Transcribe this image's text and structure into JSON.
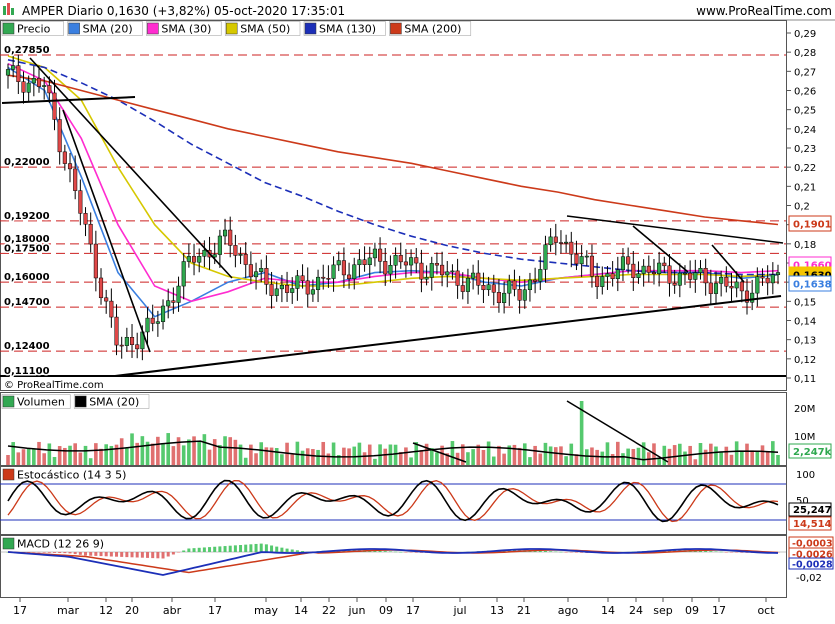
{
  "header": {
    "title": "AMPER Diario 0,1630 (+3,82%) 05-oct-2020 17:35:01",
    "site": "www.ProRealTime.com"
  },
  "price_panel": {
    "legend": [
      {
        "label": "Precio",
        "color": "#32a852",
        "icon": "candle-icon"
      },
      {
        "label": "SMA (20)",
        "color": "#3a7fe0"
      },
      {
        "label": "SMA (30)",
        "color": "#ff2cd0"
      },
      {
        "label": "SMA (50)",
        "color": "#d6c800"
      },
      {
        "label": "SMA (130)",
        "color": "#1c2fb8"
      },
      {
        "label": "SMA (200)",
        "color": "#cc3a1a"
      }
    ],
    "level_labels": [
      "0,27850",
      "0,22000",
      "0,19200",
      "0,18000",
      "0,17500",
      "0,16000",
      "0,14700",
      "0,12400",
      "0,11100"
    ],
    "right_badges": [
      {
        "text": "0,1901",
        "color": "#cc3a1a",
        "text_color": "#cc3a1a"
      },
      {
        "text": "0,1660",
        "color": "#ff2cd0",
        "text_color": "#ff2cd0"
      },
      {
        "text": "0,1630",
        "color": "#f5c500",
        "text_color": "#000000"
      },
      {
        "text": "0,1638",
        "color": "#3a7fe0",
        "text_color": "#3a7fe0"
      }
    ],
    "copyright": "© ProRealTime.com"
  },
  "volume_panel": {
    "legend": [
      {
        "label": "Volumen",
        "color": "#32a852",
        "icon": "bar-icon"
      },
      {
        "label": "SMA (20)",
        "color": "#000000"
      }
    ],
    "axis_ticks": [
      "20M",
      "10M"
    ],
    "badge": "2,247k"
  },
  "stoch_panel": {
    "legend": [
      {
        "label": "Estocástico (14 3 5)",
        "color": "#cc3a1a",
        "icon": "bar-icon"
      }
    ],
    "axis_ticks": [
      "100",
      "50",
      "0"
    ],
    "badges": [
      {
        "text": "25,247",
        "color": "#000000"
      },
      {
        "text": "14,514",
        "color": "#cc3a1a"
      }
    ]
  },
  "macd_panel": {
    "legend": [
      {
        "label": "MACD (12 26 9)",
        "color": "#32a852",
        "icon": "bar-icon"
      }
    ],
    "axis_ticks": [
      "0,00",
      "-0,02"
    ],
    "badges": [
      {
        "text": "-0,0003",
        "color": "#cc3a1a"
      },
      {
        "text": "-0,0026",
        "color": "#cc3a1a"
      },
      {
        "text": "-0,0028",
        "color": "#1c2fb8"
      }
    ]
  },
  "x_axis_labels": [
    "17",
    "mar",
    "12",
    "20",
    "abr",
    "17",
    "may",
    "14",
    "22",
    "jun",
    "09",
    "17",
    "jul",
    "13",
    "21",
    "ago",
    "14",
    "24",
    "sep",
    "09",
    "17",
    "oct"
  ],
  "chart_data": {
    "type": "line",
    "title": "AMPER Diario 0,1630 (+3,82%) 05-oct-2020 17:35:01",
    "y_axis_ticks": [
      "0,29",
      "0,28",
      "0,27",
      "0,26",
      "0,25",
      "0,24",
      "0,23",
      "0,22",
      "0,21",
      "0,2",
      "0,19",
      "0,18",
      "0,17",
      "0,16",
      "0,15",
      "0,14",
      "0,13",
      "0,12",
      "0,11"
    ],
    "ylim": [
      0.11,
      0.29
    ],
    "x": [
      "17",
      "mar",
      "12",
      "20",
      "abr",
      "17",
      "may",
      "14",
      "22",
      "jun",
      "09",
      "17",
      "jul",
      "13",
      "21",
      "ago",
      "14",
      "24",
      "sep",
      "09",
      "17",
      "oct"
    ],
    "series": [
      {
        "name": "Precio",
        "values": [
          0.268,
          0.262,
          0.195,
          0.125,
          0.138,
          0.172,
          0.182,
          0.158,
          0.157,
          0.166,
          0.172,
          0.169,
          0.164,
          0.157,
          0.153,
          0.185,
          0.162,
          0.168,
          0.164,
          0.162,
          0.155,
          0.163
        ]
      },
      {
        "name": "SMA (20)",
        "values": [
          0.272,
          0.26,
          0.215,
          0.165,
          0.142,
          0.15,
          0.16,
          0.165,
          0.158,
          0.16,
          0.165,
          0.166,
          0.165,
          0.16,
          0.158,
          0.162,
          0.164,
          0.166,
          0.165,
          0.165,
          0.162,
          0.1638
        ]
      },
      {
        "name": "SMA (30)",
        "values": [
          0.274,
          0.265,
          0.235,
          0.19,
          0.158,
          0.15,
          0.155,
          0.162,
          0.16,
          0.16,
          0.163,
          0.165,
          0.165,
          0.162,
          0.16,
          0.162,
          0.164,
          0.166,
          0.166,
          0.166,
          0.165,
          0.166
        ]
      },
      {
        "name": "SMA (50)",
        "values": [
          0.278,
          0.272,
          0.255,
          0.22,
          0.19,
          0.17,
          0.163,
          0.16,
          0.158,
          0.158,
          0.16,
          0.162,
          0.163,
          0.162,
          0.161,
          0.162,
          0.163,
          0.164,
          0.164,
          0.164,
          0.163,
          0.164
        ]
      },
      {
        "name": "SMA (130)",
        "values": [
          0.276,
          0.272,
          0.264,
          0.255,
          0.244,
          0.232,
          0.222,
          0.212,
          0.205,
          0.197,
          0.19,
          0.184,
          0.179,
          0.175,
          0.172,
          0.17,
          0.168,
          0.166,
          0.165,
          0.165,
          0.164,
          0.164
        ]
      },
      {
        "name": "SMA (200)",
        "values": [
          0.268,
          0.265,
          0.26,
          0.255,
          0.25,
          0.245,
          0.24,
          0.236,
          0.232,
          0.228,
          0.225,
          0.222,
          0.218,
          0.214,
          0.21,
          0.207,
          0.203,
          0.2,
          0.197,
          0.194,
          0.192,
          0.1901
        ]
      }
    ],
    "grid": false,
    "legend_position": "top-left"
  }
}
